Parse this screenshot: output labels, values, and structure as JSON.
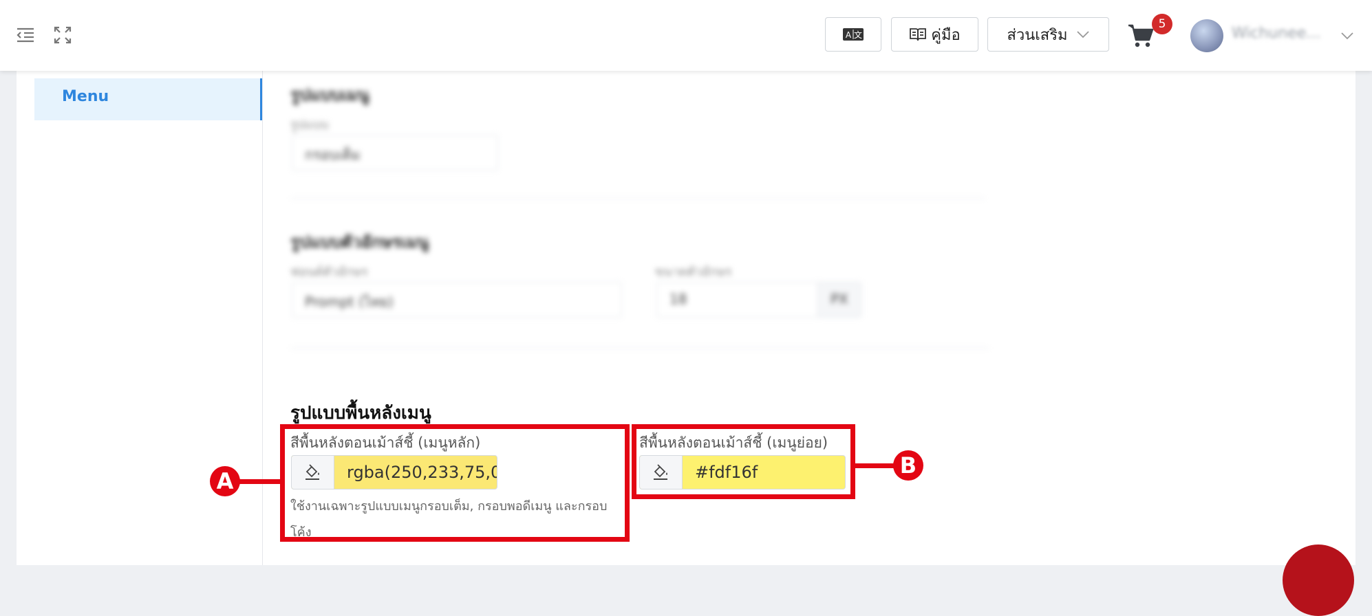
{
  "header": {
    "menu_collapse_icon": "indent-icon",
    "fullscreen_icon": "expand-icon",
    "translate_icon": "translate-icon",
    "manual_label": "คู่มือ",
    "manual_icon": "book-icon",
    "addons_label": "ส่วนเสริม",
    "cart_icon": "cart-icon",
    "cart_count": "5",
    "username": "Wichunee..."
  },
  "sidebar": {
    "active_item": "Menu"
  },
  "blurred": {
    "section1_title": "รูปแบบเมนู",
    "section1_label": "รูปแบบ",
    "section1_value": "กรอบเต็ม",
    "section2_title": "รูปแบบตัวอักษรเมนู",
    "font_label": "ฟอนต์ตัวอักษร",
    "font_value": "Prompt (ไทย)",
    "size_label": "ขนาดตัวอักษร",
    "size_value": "18",
    "size_unit": "PX"
  },
  "background_section": {
    "title": "รูปแบบพื้นหลังเมนู",
    "main_hover": {
      "label": "สีพื้นหลังตอนเม้าส์ชี้ (เมนูหลัก)",
      "value": "rgba(250,233,75,0",
      "help": "ใช้งานเฉพาะรูปแบบเมนูกรอบเต็ม, กรอบพอดีเมนู และกรอบโค้ง"
    },
    "sub_hover": {
      "label": "สีพื้นหลังตอนเม้าส์ชี้ (เมนูย่อย)",
      "value": "#fdf16f"
    }
  },
  "annotations": {
    "marker_a": "A",
    "marker_b": "B"
  },
  "colors": {
    "highlight": "#e30613",
    "active_blue": "#2e86de",
    "field_yellow_a": "#fbe874",
    "field_yellow_b": "#fdf16f"
  }
}
